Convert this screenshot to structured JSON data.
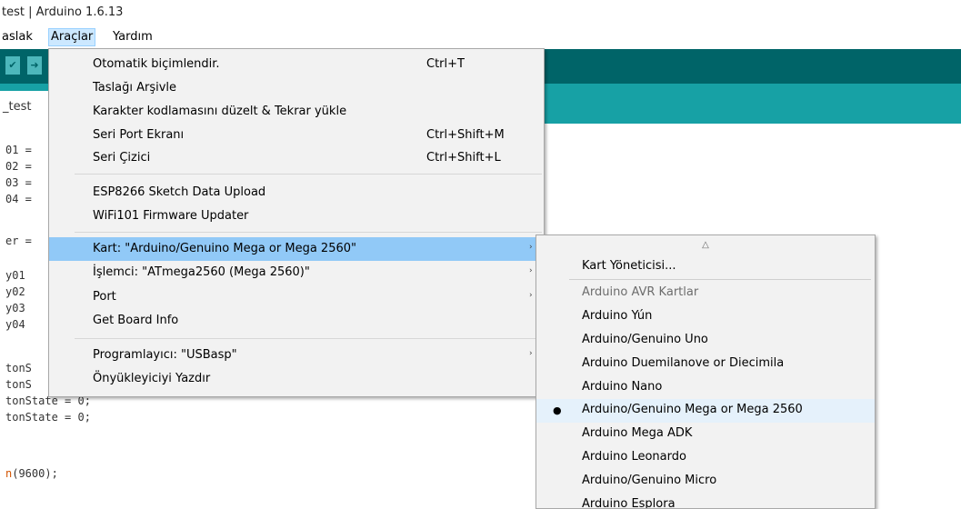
{
  "window": {
    "title": "test | Arduino 1.6.13"
  },
  "menubar": {
    "items": [
      "aslak",
      "Araçlar",
      "Yardım"
    ]
  },
  "toolbar": {
    "btn1": "✔",
    "btn2": "➜"
  },
  "tab": {
    "label": "_test"
  },
  "code_lines": [
    "01 =",
    "02 =",
    "03 =",
    "04 =",
    "er =",
    "y01",
    "y02",
    "y03",
    "y04",
    "tonS",
    "tonS",
    "tonState = 0;",
    "tonState = 0;",
    "(9600);"
  ],
  "code_fn_prefix": "n",
  "menu": {
    "items": [
      {
        "label": "Otomatik biçimlendir.",
        "shortcut": "Ctrl+T"
      },
      {
        "label": "Taslağı Arşivle",
        "shortcut": ""
      },
      {
        "label": "Karakter kodlamasını düzelt & Tekrar yükle",
        "shortcut": ""
      },
      {
        "label": "Seri Port Ekranı",
        "shortcut": "Ctrl+Shift+M"
      },
      {
        "label": "Seri Çizici",
        "shortcut": "Ctrl+Shift+L"
      },
      {
        "label": "ESP8266 Sketch Data Upload",
        "shortcut": ""
      },
      {
        "label": "WiFi101 Firmware Updater",
        "shortcut": ""
      },
      {
        "label": "Kart: \"Arduino/Genuino Mega or Mega 2560\"",
        "shortcut": ""
      },
      {
        "label": "İşlemci: \"ATmega2560 (Mega 2560)\"",
        "shortcut": ""
      },
      {
        "label": "Port",
        "shortcut": ""
      },
      {
        "label": "Get Board Info",
        "shortcut": ""
      },
      {
        "label": "Programlayıcı: \"USBasp\"",
        "shortcut": ""
      },
      {
        "label": "Önyükleyiciyi Yazdır",
        "shortcut": ""
      }
    ],
    "submenu_arrow": "›"
  },
  "submenu": {
    "scroll_up": "△",
    "manager": "Kart Yöneticisi...",
    "section_header": "Arduino AVR Kartlar",
    "boards": [
      "Arduino Yún",
      "Arduino/Genuino Uno",
      "Arduino Duemilanove or Diecimila",
      "Arduino Nano",
      "Arduino/Genuino Mega or Mega 2560",
      "Arduino Mega ADK",
      "Arduino Leonardo",
      "Arduino/Genuino Micro",
      "Arduino Esplora"
    ],
    "selected_marker": "●"
  }
}
